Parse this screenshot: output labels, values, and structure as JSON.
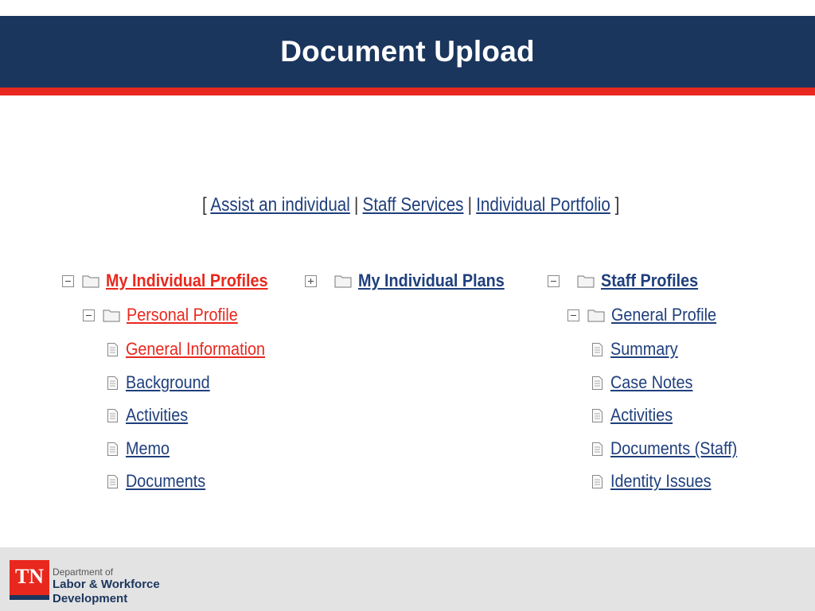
{
  "slide": {
    "title": "Document Upload"
  },
  "nav": {
    "open_bracket": "[",
    "close_bracket": "]",
    "separator": "|",
    "links": [
      "Assist an individual",
      "Staff Services",
      "Individual Portfolio"
    ]
  },
  "tree": {
    "my_individual_profiles": {
      "label": "My Individual Profiles",
      "expanded": true,
      "personal_profile": {
        "label": "Personal Profile",
        "expanded": true,
        "items": [
          "General Information",
          "Background",
          "Activities",
          "Memo",
          "Documents"
        ]
      }
    },
    "my_individual_plans": {
      "label": "My Individual Plans",
      "expanded": false
    },
    "staff_profiles": {
      "label": "Staff Profiles",
      "expanded": true,
      "general_profile": {
        "label": "General Profile",
        "expanded": true,
        "items": [
          "Summary",
          "Case Notes",
          "Activities",
          "Documents (Staff)",
          "Identity Issues"
        ]
      }
    }
  },
  "footer": {
    "logo_text": "TN",
    "dept_line1": "Department of",
    "dept_line2": "Labor & Workforce",
    "dept_line3": "Development"
  },
  "colors": {
    "navy": "#1b365d",
    "red": "#e8281e",
    "link_blue": "#1f3f7c",
    "footer_gray": "#e3e3e3"
  },
  "icons": {
    "expanded": "minus-box-icon",
    "collapsed": "plus-box-icon",
    "folder": "folder-icon",
    "page": "document-page-icon"
  }
}
